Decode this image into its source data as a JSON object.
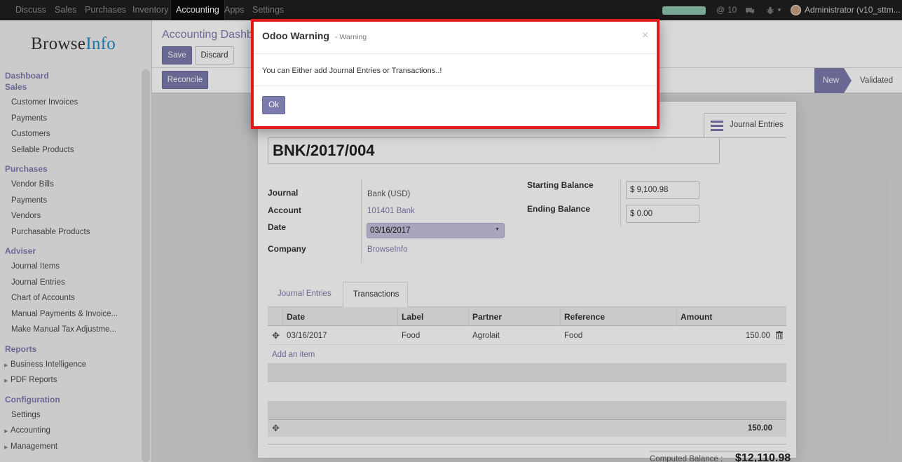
{
  "topbar": {
    "apps": [
      "Discuss",
      "Sales",
      "Purchases",
      "Inventory",
      "Accounting",
      "Apps",
      "Settings"
    ],
    "active_app": "Accounting",
    "messages_count": "10",
    "user": "Administrator (v10_sttm..."
  },
  "sidebar": {
    "logo_part1": "Browse",
    "logo_part2": "Info",
    "sections": [
      {
        "title": "Dashboard",
        "items": []
      },
      {
        "title": "Sales",
        "items": [
          "Customer Invoices",
          "Payments",
          "Customers",
          "Sellable Products"
        ]
      },
      {
        "title": "Purchases",
        "items": [
          "Vendor Bills",
          "Payments",
          "Vendors",
          "Purchasable Products"
        ]
      },
      {
        "title": "Adviser",
        "items": [
          "Journal Items",
          "Journal Entries",
          "Chart of Accounts",
          "Manual Payments & Invoice...",
          "Make Manual Tax Adjustme..."
        ]
      },
      {
        "title": "Reports",
        "items": [
          "Business Intelligence",
          "PDF Reports"
        ]
      },
      {
        "title": "Configuration",
        "items": [
          "Settings",
          "Accounting",
          "Management"
        ]
      }
    ]
  },
  "control_panel": {
    "breadcrumb": "Accounting Dashb",
    "save_label": "Save",
    "discard_label": "Discard",
    "reconcile_label": "Reconcile",
    "status_new": "New",
    "status_validated": "Validated"
  },
  "form": {
    "smart_button_label": "Journal Entries",
    "name": "BNK/2017/004",
    "journal_label": "Journal",
    "journal_value": "Bank (USD)",
    "account_label": "Account",
    "account_value": "101401 Bank",
    "date_label": "Date",
    "date_value": "03/16/2017",
    "company_label": "Company",
    "company_value": "BrowseInfo",
    "starting_balance_label": "Starting Balance",
    "starting_balance_value": "$ 9,100.98",
    "ending_balance_label": "Ending Balance",
    "ending_balance_value": "$ 0.00",
    "tabs": [
      "Journal Entries",
      "Transactions"
    ],
    "active_tab": "Transactions",
    "table_headers": [
      "Date",
      "Label",
      "Partner",
      "Reference",
      "Amount"
    ],
    "rows": [
      {
        "date": "03/16/2017",
        "label": "Food",
        "partner": "Agrolait",
        "reference": "Food",
        "amount": "150.00"
      }
    ],
    "add_item_label": "Add an item",
    "total_amount": "150.00",
    "computed_balance_label": "Computed Balance :",
    "computed_balance_value": "$12,110.98"
  },
  "modal": {
    "title": "Odoo Warning",
    "subtitle": "- Warning",
    "close_symbol": "×",
    "message": "You can Either add Journal Entries or Transactions..!",
    "ok_label": "Ok"
  }
}
